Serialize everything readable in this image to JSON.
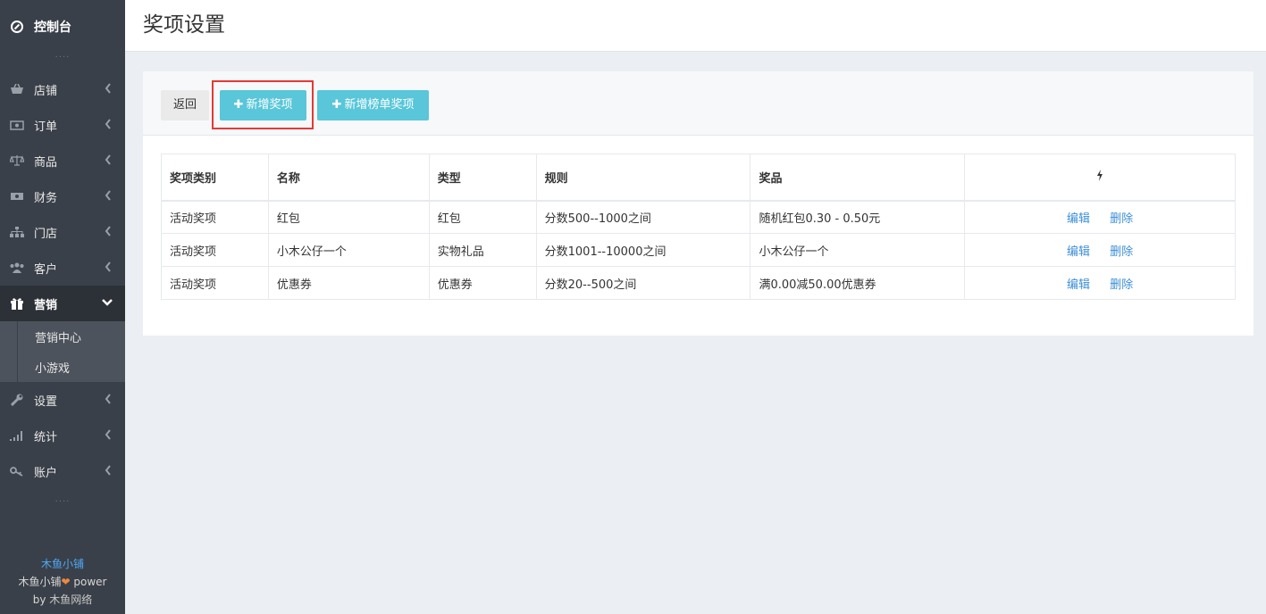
{
  "sidebar": {
    "brand": "控制台",
    "items": [
      {
        "label": "店铺",
        "icon": "basket-icon"
      },
      {
        "label": "订单",
        "icon": "money-icon"
      },
      {
        "label": "商品",
        "icon": "scale-icon"
      },
      {
        "label": "财务",
        "icon": "cash-icon"
      },
      {
        "label": "门店",
        "icon": "sitemap-icon"
      },
      {
        "label": "客户",
        "icon": "users-icon"
      },
      {
        "label": "营销",
        "icon": "gift-icon"
      },
      {
        "label": "设置",
        "icon": "wrench-icon"
      },
      {
        "label": "统计",
        "icon": "signal-icon"
      },
      {
        "label": "账户",
        "icon": "key-icon"
      }
    ],
    "submenu": [
      "营销中心",
      "小游戏"
    ],
    "footer": {
      "name": "木鱼小铺",
      "line2_prefix": "木鱼小铺",
      "heart": "❤",
      "line2_suffix": " power",
      "line3_prefix": "by ",
      "line3_name": "木鱼网络"
    }
  },
  "header": {
    "title": "奖项设置"
  },
  "toolbar": {
    "back_label": "返回",
    "add_label": "新增奖项",
    "add_rank_label": "新增榜单奖项",
    "plus": "✚"
  },
  "table": {
    "headers": [
      "奖项类别",
      "名称",
      "类型",
      "规则",
      "奖品"
    ],
    "ops_icon": "bolt-icon",
    "edit_label": "编辑",
    "delete_label": "删除",
    "rows": [
      [
        "活动奖项",
        "红包",
        "红包",
        "分数500--1000之间",
        "随机红包0.30 - 0.50元"
      ],
      [
        "活动奖项",
        "小木公仔一个",
        "实物礼品",
        "分数1001--10000之间",
        "小木公仔一个"
      ],
      [
        "活动奖项",
        "优惠券",
        "优惠券",
        "分数20--500之间",
        "满0.00减50.00优惠券"
      ]
    ]
  }
}
